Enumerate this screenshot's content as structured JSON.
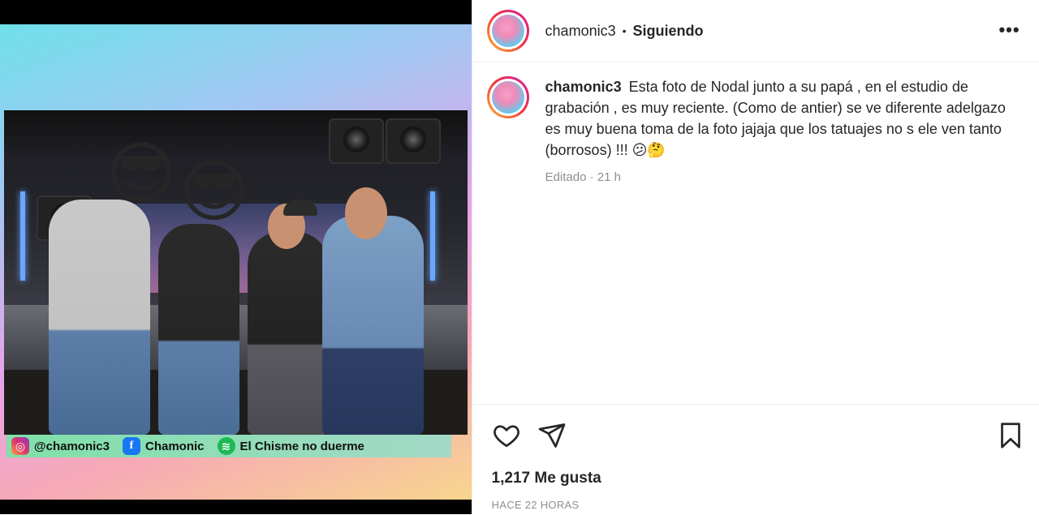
{
  "header": {
    "username": "chamonic3",
    "separator": "•",
    "follow_status": "Siguiendo",
    "more_label": "•••"
  },
  "media": {
    "emoji_left": "😎",
    "emoji_right": "😎",
    "social_bar": {
      "instagram_handle": "@chamonic3",
      "facebook_name": "Chamonic",
      "spotify_name": "El Chisme no duerme",
      "facebook_glyph": "f",
      "spotify_glyph": "≋",
      "instagram_glyph": "◎"
    }
  },
  "caption": {
    "username": "chamonic3",
    "text": "Esta foto de Nodal junto a su papá , en el estudio de grabación , es muy reciente. (Como de antier) se ve diferente adelgazo es muy buena toma de la foto jajaja que los tatuajes no s ele ven tanto (borrosos) !!! 😕🤔",
    "meta": "Editado · 21 h"
  },
  "actions": {
    "icons": [
      "heart-icon",
      "share-icon",
      "bookmark-icon"
    ],
    "likes": "1,217 Me gusta",
    "posted": "HACE 22 HORAS"
  },
  "colors": {
    "text": "#262626",
    "muted": "#8e8e8e",
    "divider": "#efefef"
  }
}
